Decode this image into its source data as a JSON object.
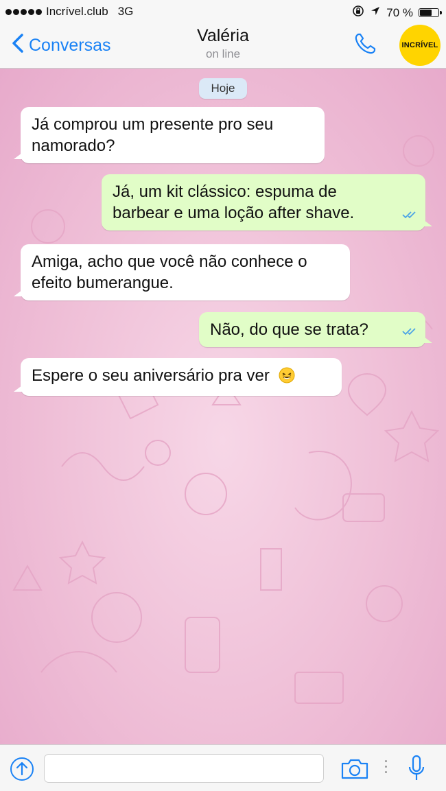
{
  "status_bar": {
    "carrier": "Incrível.club",
    "network": "3G",
    "battery_text": "70 %",
    "battery_level": 0.7
  },
  "nav": {
    "back_label": "Conversas",
    "contact_name": "Valéria",
    "contact_status": "on line",
    "avatar_text": "INCRÍVEL",
    "icons": [
      "chevron-left-icon",
      "phone-icon"
    ]
  },
  "chat": {
    "date_label": "Hoje",
    "messages": [
      {
        "direction": "in",
        "text": "Já comprou um presente pro seu namorado?"
      },
      {
        "direction": "out",
        "text": "Já, um kit clássico: espuma de barbear e uma loção after shave.",
        "status": "read"
      },
      {
        "direction": "in",
        "text": "Amiga, acho que você não conhece o efeito bumerangue."
      },
      {
        "direction": "out",
        "text": "Não, do que se trata?",
        "status": "read"
      },
      {
        "direction": "in",
        "text": "Espere o seu aniversário pra ver",
        "emoji": "laughing-face"
      }
    ]
  },
  "input_bar": {
    "text_value": "",
    "placeholder": "",
    "icons": [
      "upload-icon",
      "camera-icon",
      "microphone-icon"
    ]
  },
  "colors": {
    "accent": "#1a82f5",
    "outgoing_bubble": "#e1fdc7",
    "incoming_bubble": "#ffffff",
    "chat_background": "#efc0d8",
    "avatar_bg": "#ffd400",
    "read_ticks": "#4aa3e6"
  }
}
